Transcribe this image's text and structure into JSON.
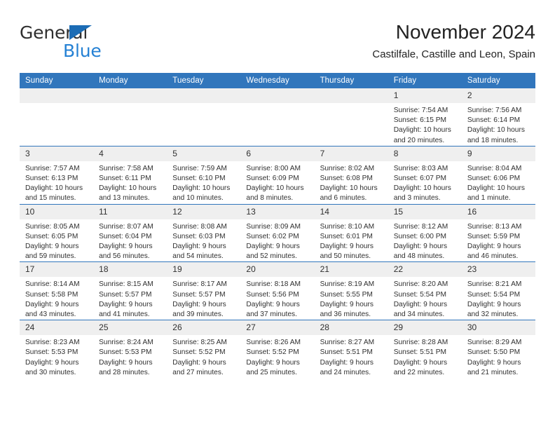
{
  "brand": {
    "name_part1": "General",
    "name_part2": "Blue",
    "triangle_color": "#1b6cb5",
    "blue_text_color": "#2581d4"
  },
  "header": {
    "title": "November 2024",
    "location": "Castilfale, Castille and Leon, Spain"
  },
  "theme": {
    "header_bg": "#3176bc",
    "daynum_bg": "#efefef",
    "row_divider": "#3176bc",
    "text": "#303030"
  },
  "weekday_headers": [
    "Sunday",
    "Monday",
    "Tuesday",
    "Wednesday",
    "Thursday",
    "Friday",
    "Saturday"
  ],
  "labels": {
    "sunrise_prefix": "Sunrise:",
    "sunset_prefix": "Sunset:",
    "daylight_prefix": "Daylight:"
  },
  "weeks": [
    [
      {
        "day": "",
        "empty": true
      },
      {
        "day": "",
        "empty": true
      },
      {
        "day": "",
        "empty": true
      },
      {
        "day": "",
        "empty": true
      },
      {
        "day": "",
        "empty": true
      },
      {
        "day": "1",
        "sunrise": "Sunrise: 7:54 AM",
        "sunset": "Sunset: 6:15 PM",
        "daylight": "Daylight: 10 hours and 20 minutes."
      },
      {
        "day": "2",
        "sunrise": "Sunrise: 7:56 AM",
        "sunset": "Sunset: 6:14 PM",
        "daylight": "Daylight: 10 hours and 18 minutes."
      }
    ],
    [
      {
        "day": "3",
        "sunrise": "Sunrise: 7:57 AM",
        "sunset": "Sunset: 6:13 PM",
        "daylight": "Daylight: 10 hours and 15 minutes."
      },
      {
        "day": "4",
        "sunrise": "Sunrise: 7:58 AM",
        "sunset": "Sunset: 6:11 PM",
        "daylight": "Daylight: 10 hours and 13 minutes."
      },
      {
        "day": "5",
        "sunrise": "Sunrise: 7:59 AM",
        "sunset": "Sunset: 6:10 PM",
        "daylight": "Daylight: 10 hours and 10 minutes."
      },
      {
        "day": "6",
        "sunrise": "Sunrise: 8:00 AM",
        "sunset": "Sunset: 6:09 PM",
        "daylight": "Daylight: 10 hours and 8 minutes."
      },
      {
        "day": "7",
        "sunrise": "Sunrise: 8:02 AM",
        "sunset": "Sunset: 6:08 PM",
        "daylight": "Daylight: 10 hours and 6 minutes."
      },
      {
        "day": "8",
        "sunrise": "Sunrise: 8:03 AM",
        "sunset": "Sunset: 6:07 PM",
        "daylight": "Daylight: 10 hours and 3 minutes."
      },
      {
        "day": "9",
        "sunrise": "Sunrise: 8:04 AM",
        "sunset": "Sunset: 6:06 PM",
        "daylight": "Daylight: 10 hours and 1 minute."
      }
    ],
    [
      {
        "day": "10",
        "sunrise": "Sunrise: 8:05 AM",
        "sunset": "Sunset: 6:05 PM",
        "daylight": "Daylight: 9 hours and 59 minutes."
      },
      {
        "day": "11",
        "sunrise": "Sunrise: 8:07 AM",
        "sunset": "Sunset: 6:04 PM",
        "daylight": "Daylight: 9 hours and 56 minutes."
      },
      {
        "day": "12",
        "sunrise": "Sunrise: 8:08 AM",
        "sunset": "Sunset: 6:03 PM",
        "daylight": "Daylight: 9 hours and 54 minutes."
      },
      {
        "day": "13",
        "sunrise": "Sunrise: 8:09 AM",
        "sunset": "Sunset: 6:02 PM",
        "daylight": "Daylight: 9 hours and 52 minutes."
      },
      {
        "day": "14",
        "sunrise": "Sunrise: 8:10 AM",
        "sunset": "Sunset: 6:01 PM",
        "daylight": "Daylight: 9 hours and 50 minutes."
      },
      {
        "day": "15",
        "sunrise": "Sunrise: 8:12 AM",
        "sunset": "Sunset: 6:00 PM",
        "daylight": "Daylight: 9 hours and 48 minutes."
      },
      {
        "day": "16",
        "sunrise": "Sunrise: 8:13 AM",
        "sunset": "Sunset: 5:59 PM",
        "daylight": "Daylight: 9 hours and 46 minutes."
      }
    ],
    [
      {
        "day": "17",
        "sunrise": "Sunrise: 8:14 AM",
        "sunset": "Sunset: 5:58 PM",
        "daylight": "Daylight: 9 hours and 43 minutes."
      },
      {
        "day": "18",
        "sunrise": "Sunrise: 8:15 AM",
        "sunset": "Sunset: 5:57 PM",
        "daylight": "Daylight: 9 hours and 41 minutes."
      },
      {
        "day": "19",
        "sunrise": "Sunrise: 8:17 AM",
        "sunset": "Sunset: 5:57 PM",
        "daylight": "Daylight: 9 hours and 39 minutes."
      },
      {
        "day": "20",
        "sunrise": "Sunrise: 8:18 AM",
        "sunset": "Sunset: 5:56 PM",
        "daylight": "Daylight: 9 hours and 37 minutes."
      },
      {
        "day": "21",
        "sunrise": "Sunrise: 8:19 AM",
        "sunset": "Sunset: 5:55 PM",
        "daylight": "Daylight: 9 hours and 36 minutes."
      },
      {
        "day": "22",
        "sunrise": "Sunrise: 8:20 AM",
        "sunset": "Sunset: 5:54 PM",
        "daylight": "Daylight: 9 hours and 34 minutes."
      },
      {
        "day": "23",
        "sunrise": "Sunrise: 8:21 AM",
        "sunset": "Sunset: 5:54 PM",
        "daylight": "Daylight: 9 hours and 32 minutes."
      }
    ],
    [
      {
        "day": "24",
        "sunrise": "Sunrise: 8:23 AM",
        "sunset": "Sunset: 5:53 PM",
        "daylight": "Daylight: 9 hours and 30 minutes."
      },
      {
        "day": "25",
        "sunrise": "Sunrise: 8:24 AM",
        "sunset": "Sunset: 5:53 PM",
        "daylight": "Daylight: 9 hours and 28 minutes."
      },
      {
        "day": "26",
        "sunrise": "Sunrise: 8:25 AM",
        "sunset": "Sunset: 5:52 PM",
        "daylight": "Daylight: 9 hours and 27 minutes."
      },
      {
        "day": "27",
        "sunrise": "Sunrise: 8:26 AM",
        "sunset": "Sunset: 5:52 PM",
        "daylight": "Daylight: 9 hours and 25 minutes."
      },
      {
        "day": "28",
        "sunrise": "Sunrise: 8:27 AM",
        "sunset": "Sunset: 5:51 PM",
        "daylight": "Daylight: 9 hours and 24 minutes."
      },
      {
        "day": "29",
        "sunrise": "Sunrise: 8:28 AM",
        "sunset": "Sunset: 5:51 PM",
        "daylight": "Daylight: 9 hours and 22 minutes."
      },
      {
        "day": "30",
        "sunrise": "Sunrise: 8:29 AM",
        "sunset": "Sunset: 5:50 PM",
        "daylight": "Daylight: 9 hours and 21 minutes."
      }
    ]
  ]
}
